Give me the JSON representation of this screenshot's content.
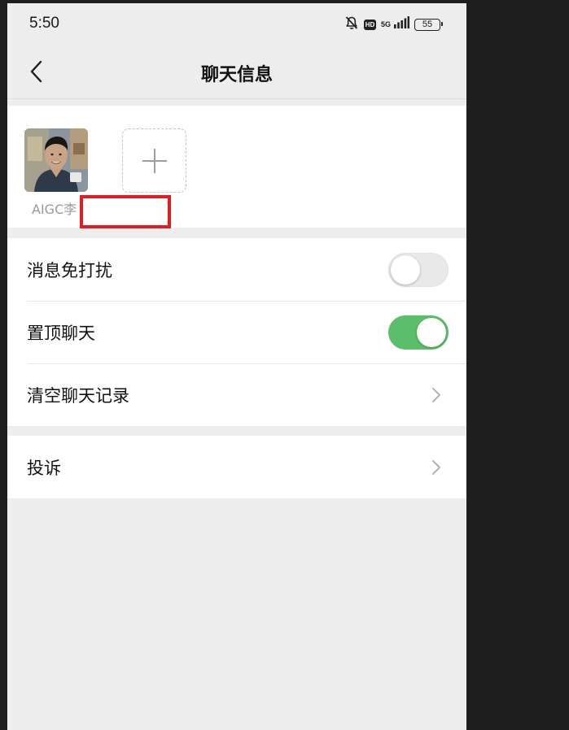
{
  "status_bar": {
    "time": "5:50",
    "hd": "HD",
    "network": "5G",
    "battery": "55"
  },
  "header": {
    "title": "聊天信息"
  },
  "members": [
    {
      "name": "AIGC李"
    }
  ],
  "settings": {
    "mute": {
      "label": "消息免打扰",
      "enabled": false
    },
    "pin": {
      "label": "置顶聊天",
      "enabled": true
    },
    "clear_history": {
      "label": "清空聊天记录"
    },
    "report": {
      "label": "投诉"
    }
  },
  "colors": {
    "toggle_on": "#5bbe6a",
    "redaction": "#e01e22",
    "page_bg": "#ededed"
  },
  "icons": [
    "back-arrow-icon",
    "mute-bell-icon",
    "signal-icon",
    "battery-icon",
    "plus-icon",
    "chevron-right-icon"
  ]
}
